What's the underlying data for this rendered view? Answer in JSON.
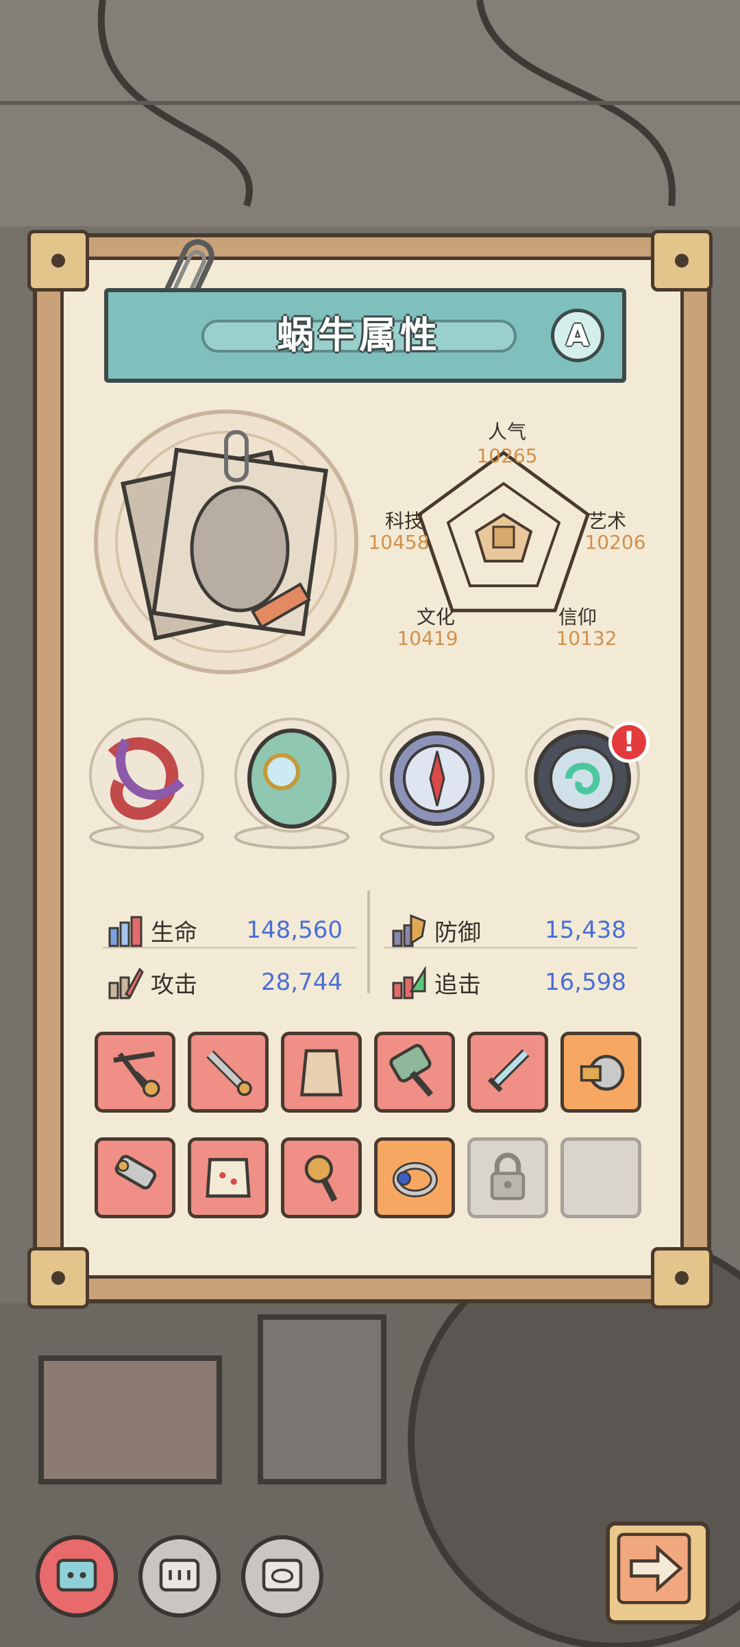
{
  "panel": {
    "title": "蜗牛属性",
    "grade": "A"
  },
  "radar": {
    "stats": [
      {
        "label": "人气",
        "value": "10265"
      },
      {
        "label": "艺术",
        "value": "10206"
      },
      {
        "label": "信仰",
        "value": "10132"
      },
      {
        "label": "文化",
        "value": "10419"
      },
      {
        "label": "科技",
        "value": "10458"
      }
    ]
  },
  "artifacts": [
    {
      "name": "thorn-tentacle-relic"
    },
    {
      "name": "jade-stone-relic"
    },
    {
      "name": "compass-relic"
    },
    {
      "name": "swirl-orb-relic",
      "alert": "!"
    }
  ],
  "combat_stats": [
    {
      "label": "生命",
      "value": "148,560",
      "icon": "health-icon"
    },
    {
      "label": "防御",
      "value": "15,438",
      "icon": "defense-icon"
    },
    {
      "label": "攻击",
      "value": "28,744",
      "icon": "attack-icon"
    },
    {
      "label": "追击",
      "value": "16,598",
      "icon": "pursuit-icon"
    }
  ],
  "equipment": [
    {
      "icon": "crossbow-icon",
      "rarity": "red"
    },
    {
      "icon": "dagger-icon",
      "rarity": "red"
    },
    {
      "icon": "coat-icon",
      "rarity": "red"
    },
    {
      "icon": "hammer-icon",
      "rarity": "red"
    },
    {
      "icon": "sword-icon",
      "rarity": "red"
    },
    {
      "icon": "wrist-gear-icon",
      "rarity": "orange"
    },
    {
      "icon": "blaster-icon",
      "rarity": "red"
    },
    {
      "icon": "vest-icon",
      "rarity": "red"
    },
    {
      "icon": "scepter-icon",
      "rarity": "red"
    },
    {
      "icon": "ring-icon",
      "rarity": "orange"
    },
    {
      "icon": "lock-icon",
      "rarity": "locked"
    },
    {
      "icon": "",
      "rarity": "empty"
    }
  ],
  "bottom_tabs": [
    {
      "icon": "snail-chip-icon",
      "active": true
    },
    {
      "icon": "chip-icon",
      "active": false
    },
    {
      "icon": "brain-chip-icon",
      "active": false
    }
  ],
  "next_button": {
    "icon": "arrow-right-icon"
  }
}
